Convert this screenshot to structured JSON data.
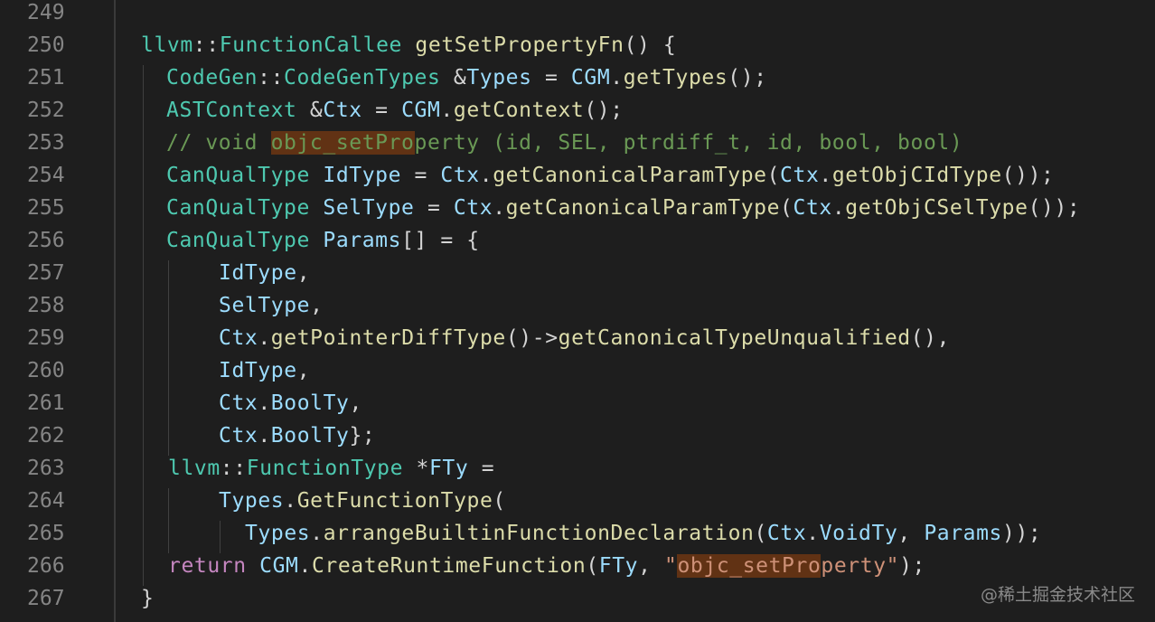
{
  "editor": {
    "line_numbers": [
      "249",
      "250",
      "251",
      "252",
      "253",
      "254",
      "255",
      "256",
      "257",
      "258",
      "259",
      "260",
      "261",
      "262",
      "263",
      "264",
      "265",
      "266",
      "267"
    ],
    "tokens": {
      "l250": [
        "llvm",
        "::",
        "FunctionCallee",
        " ",
        "getSetPropertyFn",
        "() {"
      ],
      "l251": [
        "CodeGen",
        "::",
        "CodeGenTypes",
        " &",
        "Types",
        " = ",
        "CGM",
        ".",
        "getTypes",
        "();"
      ],
      "l252": [
        "ASTContext",
        " &",
        "Ctx",
        " = ",
        "CGM",
        ".",
        "getContext",
        "();"
      ],
      "l253": [
        "// void ",
        "objc_setPro",
        "perty (id, SEL, ptrdiff_t, id, bool, bool)"
      ],
      "l254": [
        "CanQualType",
        " ",
        "IdType",
        " = ",
        "Ctx",
        ".",
        "getCanonicalParamType",
        "(",
        "Ctx",
        ".",
        "getObjCIdType",
        "());"
      ],
      "l255": [
        "CanQualType",
        " ",
        "SelType",
        " = ",
        "Ctx",
        ".",
        "getCanonicalParamType",
        "(",
        "Ctx",
        ".",
        "getObjCSelType",
        "());"
      ],
      "l256": [
        "CanQualType",
        " ",
        "Params",
        "[] = {"
      ],
      "l257": [
        "IdType",
        ","
      ],
      "l258": [
        "SelType",
        ","
      ],
      "l259": [
        "Ctx",
        ".",
        "getPointerDiffType",
        "()->",
        "getCanonicalTypeUnqualified",
        "(),"
      ],
      "l260": [
        "IdType",
        ","
      ],
      "l261": [
        "Ctx",
        ".",
        "BoolTy",
        ","
      ],
      "l262": [
        "Ctx",
        ".",
        "BoolTy",
        "};"
      ],
      "l263": [
        "llvm",
        "::",
        "FunctionType",
        " *",
        "FTy",
        " ="
      ],
      "l264": [
        "Types",
        ".",
        "GetFunctionType",
        "("
      ],
      "l265": [
        "Types",
        ".",
        "arrangeBuiltinFunctionDeclaration",
        "(",
        "Ctx",
        ".",
        "VoidTy",
        ", ",
        "Params",
        "));"
      ],
      "l266": [
        "return",
        " ",
        "CGM",
        ".",
        "CreateRuntimeFunction",
        "(",
        "FTy",
        ", ",
        "\"",
        "objc_setPro",
        "perty\"",
        ");"
      ],
      "l267": [
        "}"
      ]
    }
  },
  "watermark": "@稀土掘金技术社区",
  "colors": {
    "background": "#1e1e1e",
    "type": "#4ec9b0",
    "function": "#dcdcaa",
    "variable": "#9cdcfe",
    "keyword": "#c586c0",
    "comment": "#6a9955",
    "string": "#ce9178",
    "find_highlight": "#613214"
  }
}
